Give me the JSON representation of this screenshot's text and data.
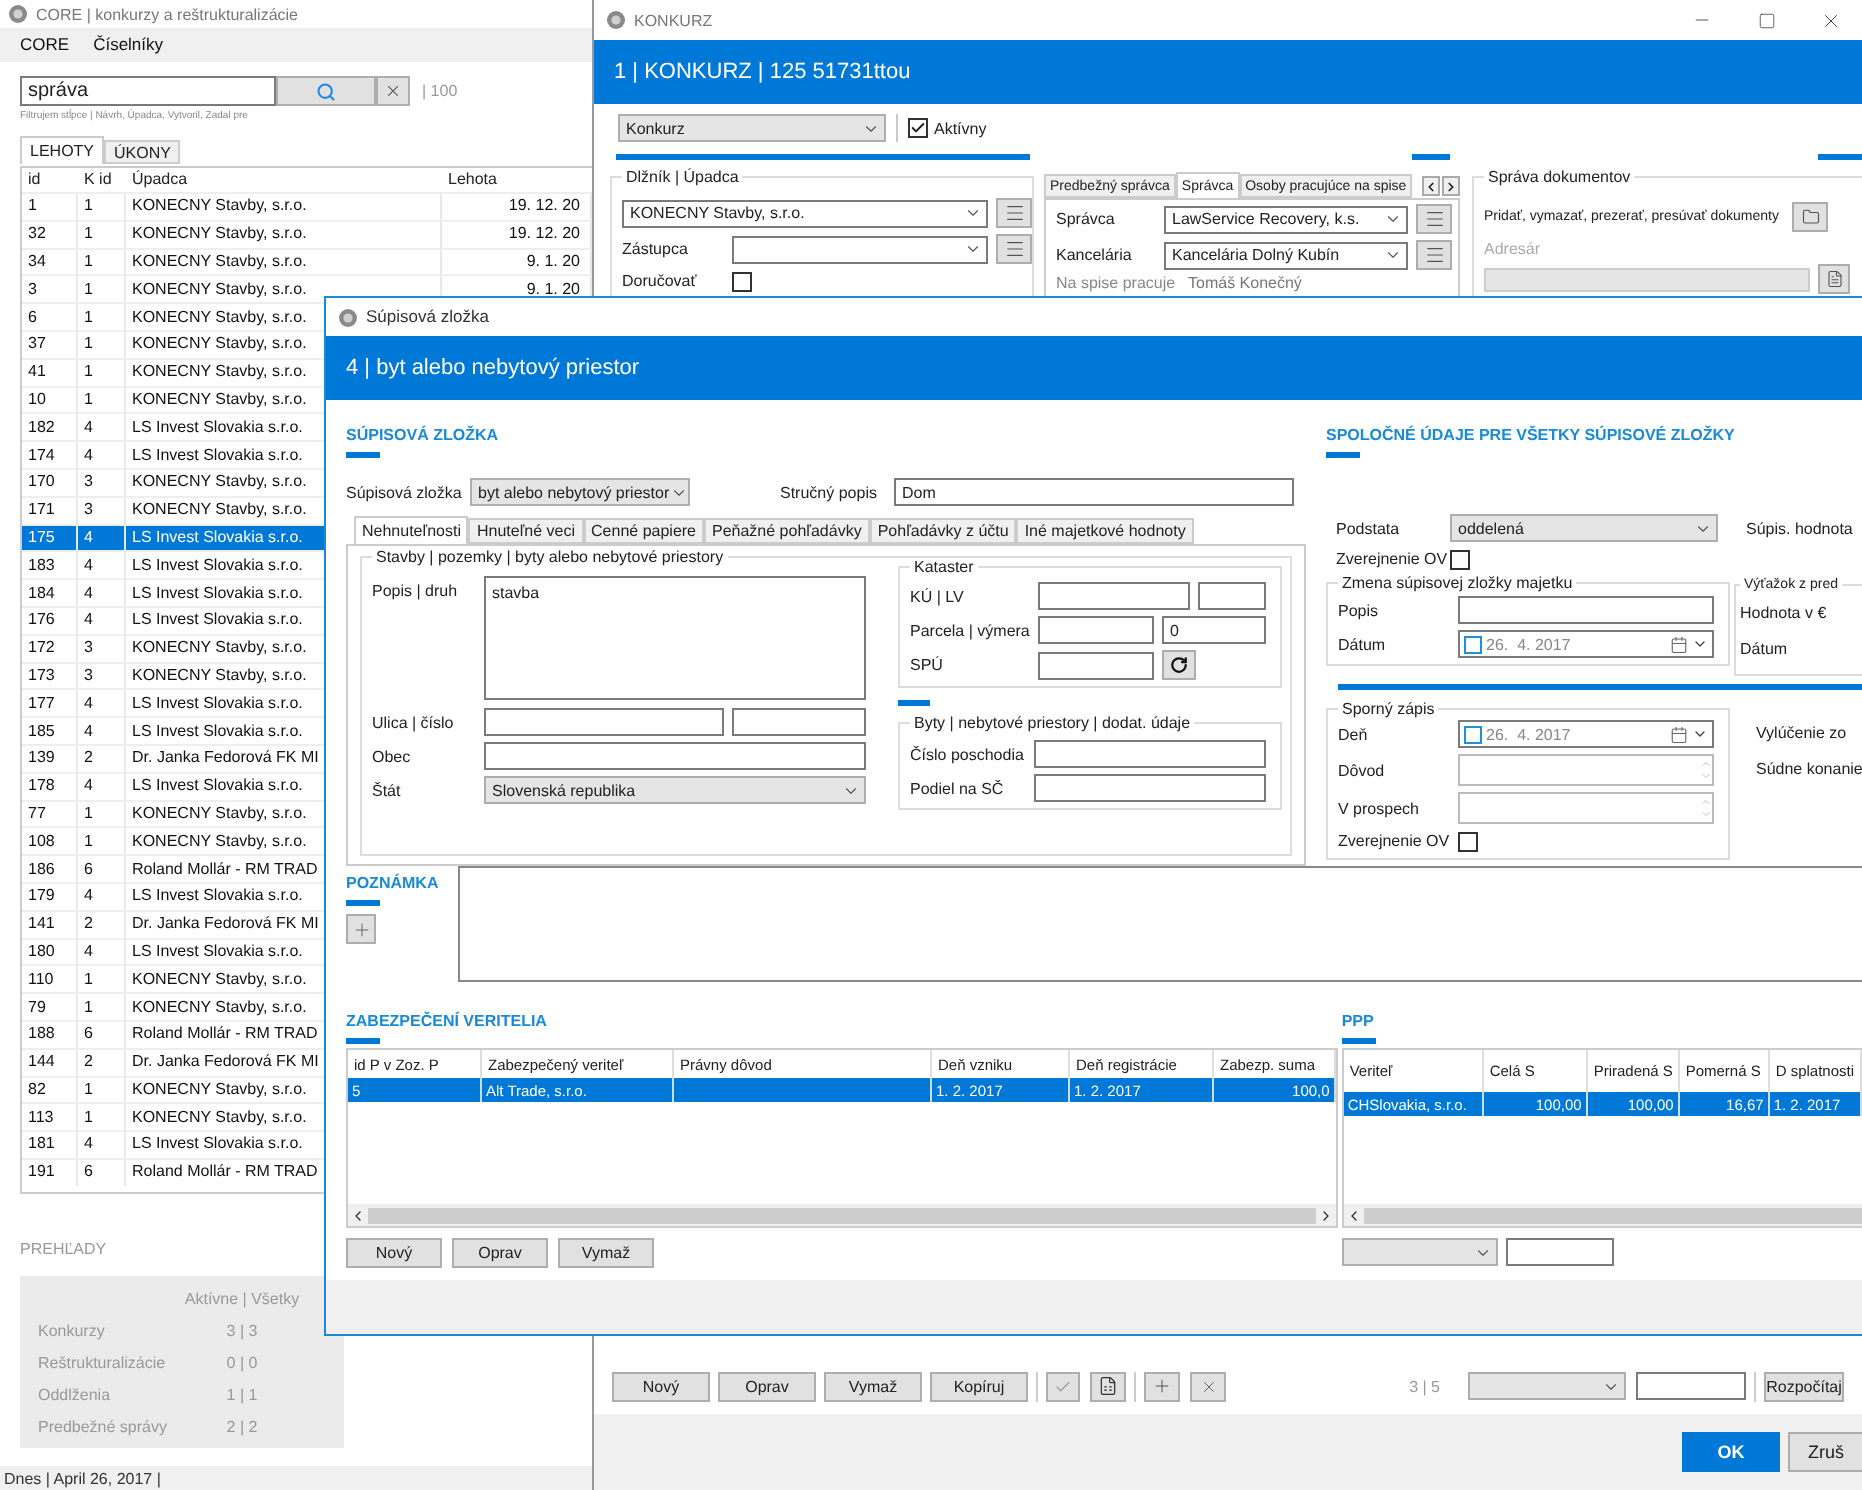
{
  "main_window": {
    "title": "CORE | konkurzy a reštrukturalizácie",
    "menu": [
      "CORE",
      "Číselníky"
    ],
    "search": {
      "value": "správa",
      "count": "| 100",
      "hint": "Filtrujem stĺpce | Návrh, Úpadca, Vytvoril, Zadal pre"
    },
    "tabs": [
      {
        "label": "LEHOTY",
        "selected": true
      },
      {
        "label": "ÚKONY",
        "selected": false
      }
    ],
    "table": {
      "columns": [
        "id",
        "K id",
        "Úpadca",
        "Lehota"
      ],
      "rows": [
        {
          "cells": [
            "1",
            "1",
            "KONECNY Stavby, s.r.o.",
            "19. 12. 20"
          ],
          "selected": false
        },
        {
          "cells": [
            "32",
            "1",
            "KONECNY Stavby, s.r.o.",
            "19. 12. 20"
          ],
          "selected": false
        },
        {
          "cells": [
            "34",
            "1",
            "KONECNY Stavby, s.r.o.",
            "9. 1. 20"
          ],
          "selected": false
        },
        {
          "cells": [
            "3",
            "1",
            "KONECNY Stavby, s.r.o.",
            "9. 1. 20"
          ],
          "selected": false
        },
        {
          "cells": [
            "6",
            "1",
            "KONECNY Stavby, s.r.o."
          ],
          "selected": false
        },
        {
          "cells": [
            "37",
            "1",
            "KONECNY Stavby, s.r.o."
          ],
          "selected": false
        },
        {
          "cells": [
            "41",
            "1",
            "KONECNY Stavby, s.r.o."
          ],
          "selected": false
        },
        {
          "cells": [
            "10",
            "1",
            "KONECNY Stavby, s.r.o."
          ],
          "selected": false
        },
        {
          "cells": [
            "182",
            "4",
            "LS Invest Slovakia s.r.o."
          ],
          "selected": false
        },
        {
          "cells": [
            "174",
            "4",
            "LS Invest Slovakia s.r.o."
          ],
          "selected": false
        },
        {
          "cells": [
            "170",
            "3",
            "KONECNY Stavby, s.r.o."
          ],
          "selected": false
        },
        {
          "cells": [
            "171",
            "3",
            "KONECNY Stavby, s.r.o."
          ],
          "selected": false
        },
        {
          "cells": [
            "175",
            "4",
            "LS Invest Slovakia s.r.o."
          ],
          "selected": true
        },
        {
          "cells": [
            "183",
            "4",
            "LS Invest Slovakia s.r.o."
          ],
          "selected": false
        },
        {
          "cells": [
            "184",
            "4",
            "LS Invest Slovakia s.r.o."
          ],
          "selected": false
        },
        {
          "cells": [
            "176",
            "4",
            "LS Invest Slovakia s.r.o."
          ],
          "selected": false
        },
        {
          "cells": [
            "172",
            "3",
            "KONECNY Stavby, s.r.o."
          ],
          "selected": false
        },
        {
          "cells": [
            "173",
            "3",
            "KONECNY Stavby, s.r.o."
          ],
          "selected": false
        },
        {
          "cells": [
            "177",
            "4",
            "LS Invest Slovakia s.r.o."
          ],
          "selected": false
        },
        {
          "cells": [
            "185",
            "4",
            "LS Invest Slovakia s.r.o."
          ],
          "selected": false
        },
        {
          "cells": [
            "139",
            "2",
            "Dr. Janka Fedorová FK MI"
          ],
          "selected": false
        },
        {
          "cells": [
            "178",
            "4",
            "LS Invest Slovakia s.r.o."
          ],
          "selected": false
        },
        {
          "cells": [
            "77",
            "1",
            "KONECNY Stavby, s.r.o."
          ],
          "selected": false
        },
        {
          "cells": [
            "108",
            "1",
            "KONECNY Stavby, s.r.o."
          ],
          "selected": false
        },
        {
          "cells": [
            "186",
            "6",
            "Roland Mollár - RM TRAD"
          ],
          "selected": false
        },
        {
          "cells": [
            "179",
            "4",
            "LS Invest Slovakia s.r.o."
          ],
          "selected": false
        },
        {
          "cells": [
            "141",
            "2",
            "Dr. Janka Fedorová FK MI"
          ],
          "selected": false
        },
        {
          "cells": [
            "180",
            "4",
            "LS Invest Slovakia s.r.o."
          ],
          "selected": false
        },
        {
          "cells": [
            "110",
            "1",
            "KONECNY Stavby, s.r.o."
          ],
          "selected": false
        },
        {
          "cells": [
            "79",
            "1",
            "KONECNY Stavby, s.r.o."
          ],
          "selected": false
        },
        {
          "cells": [
            "188",
            "6",
            "Roland Mollár - RM TRAD"
          ],
          "selected": false
        },
        {
          "cells": [
            "144",
            "2",
            "Dr. Janka Fedorová FK MI"
          ],
          "selected": false
        },
        {
          "cells": [
            "82",
            "1",
            "KONECNY Stavby, s.r.o."
          ],
          "selected": false
        },
        {
          "cells": [
            "113",
            "1",
            "KONECNY Stavby, s.r.o."
          ],
          "selected": false
        },
        {
          "cells": [
            "181",
            "4",
            "LS Invest Slovakia s.r.o."
          ],
          "selected": false
        },
        {
          "cells": [
            "191",
            "6",
            "Roland Mollár - RM TRAD"
          ],
          "selected": false
        }
      ]
    },
    "overview": {
      "title": "PREHĽADY",
      "header": "Aktívne | Všetky",
      "rows": [
        {
          "label": "Konkurzy",
          "value": "3 | 3"
        },
        {
          "label": "Reštrukturalizácie",
          "value": "0 | 0"
        },
        {
          "label": "Oddlženia",
          "value": "1 | 1"
        },
        {
          "label": "Predbežné správy",
          "value": "2 | 2"
        }
      ]
    },
    "status_bar": "Dnes | April 26, 2017 |"
  },
  "konkurz_window": {
    "title": "KONKURZ",
    "header": "1 | KONKURZ | 125 51731ttou",
    "type": "Konkurz",
    "active": {
      "label": "Aktívny",
      "checked": true
    },
    "debtor": {
      "title": "Dlžník | Úpadca",
      "value": "KONECNY Stavby, s.r.o.",
      "representative_label": "Zástupca",
      "deliver": {
        "label": "Doručovať",
        "checked": false
      }
    },
    "tabs": [
      {
        "label": "Predbežný správca",
        "selected": false
      },
      {
        "label": "Správca",
        "selected": true
      },
      {
        "label": "Osoby pracujúce na spise",
        "selected": false
      }
    ],
    "administrator": {
      "label": "Správca",
      "value": "LawService Recovery, k.s."
    },
    "office": {
      "label": "Kancelária",
      "value": "Kancelária Dolný Kubín"
    },
    "worker": {
      "label": "Na spise pracuje",
      "value": "Tomáš Konečný"
    },
    "documents": {
      "title": "Správa dokumentov",
      "text": "Pridať, vymazať, prezerať, presúvať dokumenty",
      "folder_label": "Adresár"
    },
    "buttons": [
      "Nový",
      "Oprav",
      "Vymaž",
      "Kopíruj"
    ],
    "counter": "3 | 5",
    "recalc": "Rozpočítaj",
    "ok": "OK",
    "cancel": "Zruš"
  },
  "dialog": {
    "title": "Súpisová zložka",
    "header": "4 | byt alebo nebytový priestor",
    "section_title": "SÚPISOVÁ ZLOŽKA",
    "item_label": "Súpisová zložka",
    "item_value": "byt alebo nebytový priestor",
    "short_label": "Stručný popis",
    "short_value": "Dom",
    "tabs": [
      {
        "label": "Nehnuteľnosti",
        "selected": true
      },
      {
        "label": "Hnuteľné veci",
        "selected": false
      },
      {
        "label": "Cenné papiere",
        "selected": false
      },
      {
        "label": "Peňažné pohľadávky",
        "selected": false
      },
      {
        "label": "Pohľadávky z účtu",
        "selected": false
      },
      {
        "label": "Iné majetkové hodnoty",
        "selected": false
      }
    ],
    "property": {
      "title": "Stavby | pozemky | byty alebo nebytové priestory",
      "description_label": "Popis | druh",
      "description": "stavba",
      "street_label": "Ulica | číslo",
      "city_label": "Obec",
      "country_label": "Štát",
      "country": "Slovenská republika"
    },
    "cadastre": {
      "title": "Kataster",
      "ku_label": "KÚ | LV",
      "parcel_label": "Parcela | výmera",
      "area": "0",
      "spu_label": "SPÚ"
    },
    "flats": {
      "title": "Byty | nebytové priestory | dodat. údaje",
      "floor_label": "Číslo poschodia",
      "share_label": "Podiel na SČ"
    },
    "common": {
      "title": "SPOLOČNÉ ÚDAJE PRE VŠETKY SÚPISOVÉ ZLOŽKY",
      "estate_label": "Podstata",
      "estate": "oddelená",
      "value_label": "Súpis. hodnota",
      "publish": {
        "label": "Zverejnenie OV",
        "checked": false
      },
      "change": {
        "title": "Zmena súpisovej zložky majetku",
        "description_label": "Popis",
        "date_label": "Dátum",
        "date": {
          "text": "26.  4. 2017",
          "checked": false
        }
      },
      "proceeds": {
        "title": "Výťažok z pred",
        "value_label": "Hodnota v €",
        "date_label": "Dátum"
      },
      "dispute": {
        "title": "Sporný zápis",
        "day_label": "Deň",
        "day": {
          "text": "26.  4. 2017",
          "checked": false
        },
        "reason_label": "Dôvod",
        "beneficiary_label": "V prospech",
        "publish": {
          "label": "Zverejnenie OV",
          "checked": false
        }
      },
      "exclusion_label": "Vylúčenie zo",
      "court_label": "Súdne konanie"
    },
    "note": {
      "title": "POZNÁMKA"
    },
    "security": {
      "title": "ZABEZPEČENÍ VERITELIA",
      "columns": [
        "id P v Zoz. P",
        "Zabezpečený veriteľ",
        "Právny dôvod",
        "Deň vzniku",
        "Deň registrácie",
        "Zabezp. suma"
      ],
      "rows": [
        {
          "cells": [
            "5",
            "Alt Trade, s.r.o.",
            null,
            "1. 2. 2017",
            "1. 2. 2017",
            "100,0"
          ],
          "selected": true
        }
      ],
      "buttons": [
        "Nový",
        "Oprav",
        "Vymaž"
      ]
    },
    "ppp": {
      "title": "PPP",
      "columns": [
        "Veriteľ",
        "Celá S",
        "Priradená S",
        "Pomerná S",
        "D splatnosti"
      ],
      "rows": [
        {
          "cells": [
            "CHSlovakia, s.r.o.",
            "100,00",
            "100,00",
            "16,67",
            "1. 2. 2017"
          ],
          "selected": true
        }
      ]
    }
  }
}
